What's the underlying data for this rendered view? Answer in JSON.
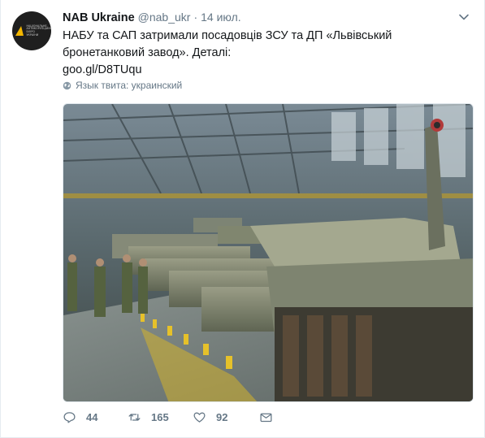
{
  "tweet": {
    "author_name": "NAB Ukraine",
    "author_handle": "@nab_ukr",
    "separator": "·",
    "timestamp": "14 июл.",
    "text": "НАБУ та САП затримали посадовців ЗСУ та ДП «Львівський бронетанковий завод». Деталі:",
    "link": "goo.gl/D8TUqu",
    "language_note": "Язык твита: украинский",
    "media_description": "tanks-in-factory-hall"
  },
  "avatar": {
    "logo_text": "НАЦІОНАЛЬНЕ АНТИКОРУПЦІЙНЕ БЮРО УКРАЇНИ",
    "brand_color": "#f3b600"
  },
  "actions": {
    "reply_count": "44",
    "retweet_count": "165",
    "like_count": "92"
  },
  "colors": {
    "text": "#14171a",
    "secondary": "#657786",
    "border": "#e6ecf0"
  }
}
